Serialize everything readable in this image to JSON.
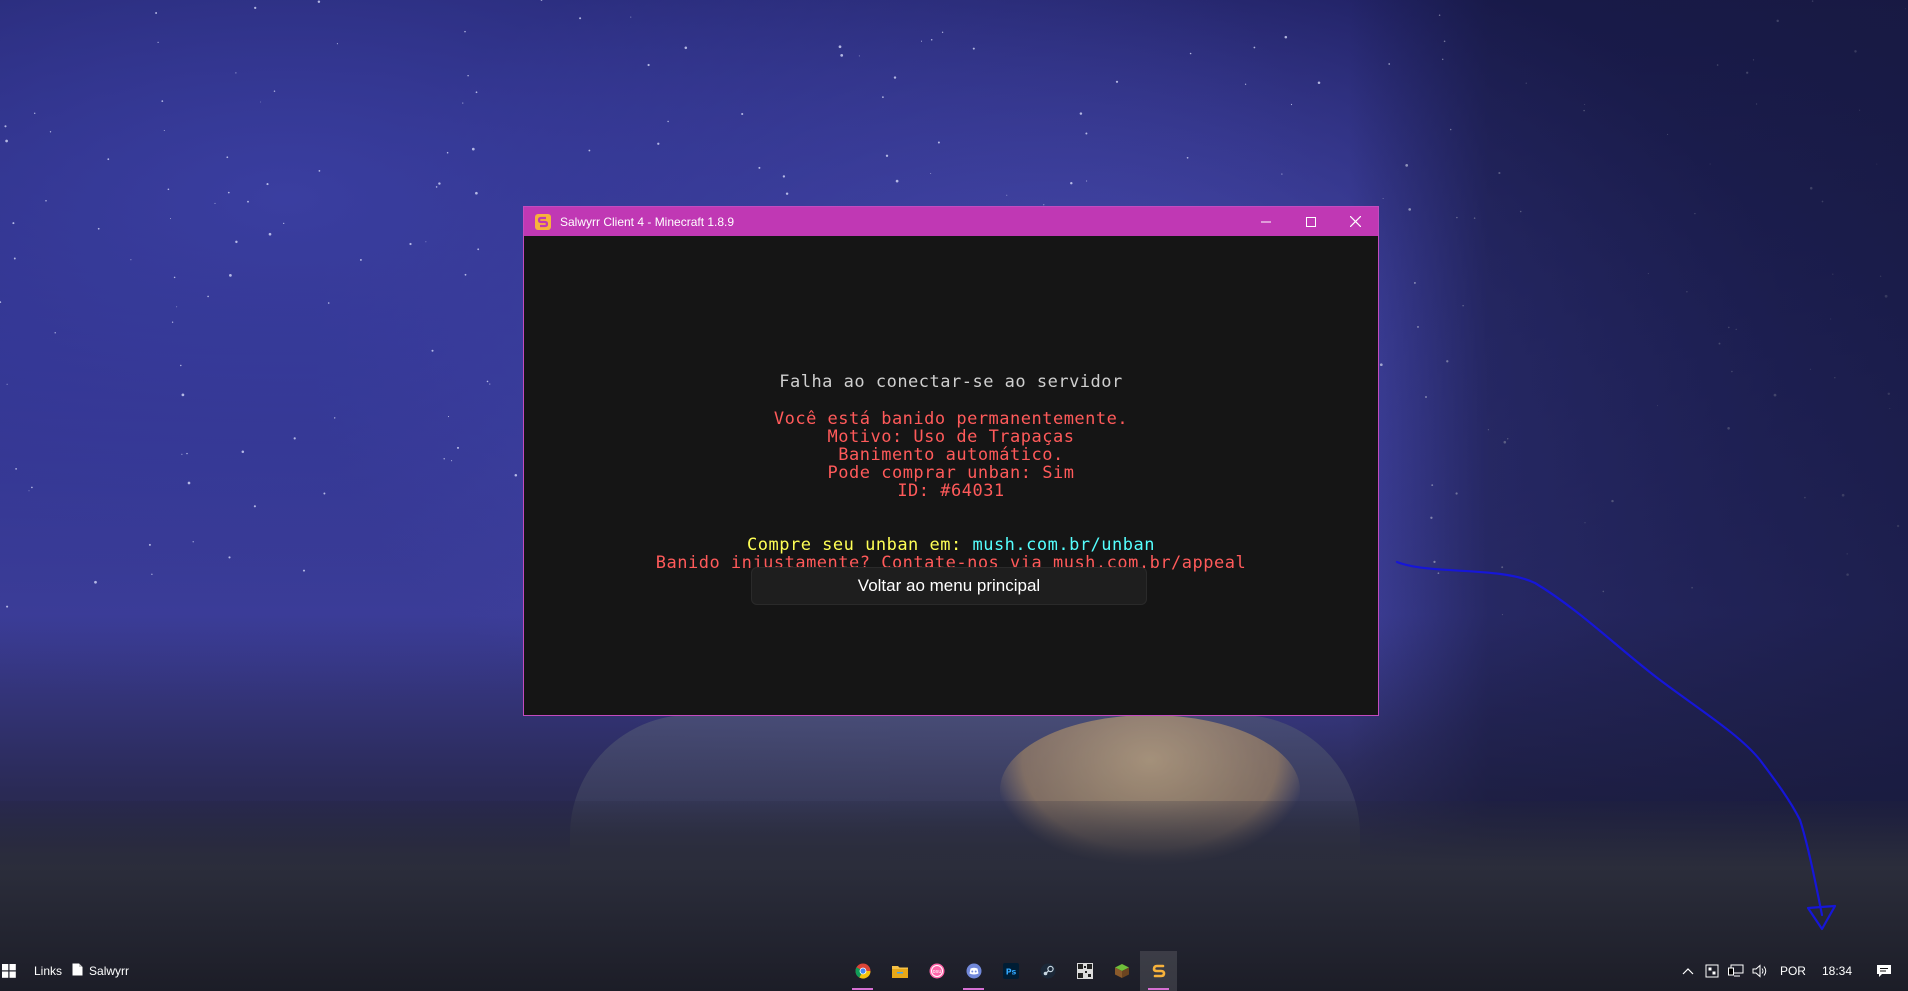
{
  "window": {
    "title": "Salwyrr Client 4 - Minecraft 1.8.9",
    "controls": [
      "minimize-icon",
      "maximize-icon",
      "close-icon"
    ],
    "accent_color": "#c038b4"
  },
  "screen": {
    "heading": "Falha ao conectar-se ao servidor",
    "reason_lines": [
      "Você está banido permanentemente.",
      "Motivo: Uso de Trapaças",
      "Banimento automático.",
      "Pode comprar unban: Sim",
      "ID: #64031"
    ],
    "buy_prefix": "Compre seu unban em: ",
    "buy_link": "mush.com.br/unban",
    "appeal_line": "Banido injustamente? Contate-nos via mush.com.br/appeal",
    "back_button": "Voltar ao menu principal",
    "colors": {
      "heading": "#cfcfcf",
      "red": "#ff5a5a",
      "yellow": "#ffff55",
      "aqua": "#55ffff"
    }
  },
  "taskbar": {
    "links_label": "Links",
    "file_label": "Salwyrr",
    "pinned_icons": [
      "chrome-icon",
      "file-explorer-icon",
      "osu-icon",
      "discord-icon",
      "photoshop-icon",
      "steam-icon",
      "qr-app-icon",
      "minecraft-icon",
      "salwyrr-icon"
    ],
    "tray": {
      "language": "POR",
      "time": "18:34"
    }
  }
}
